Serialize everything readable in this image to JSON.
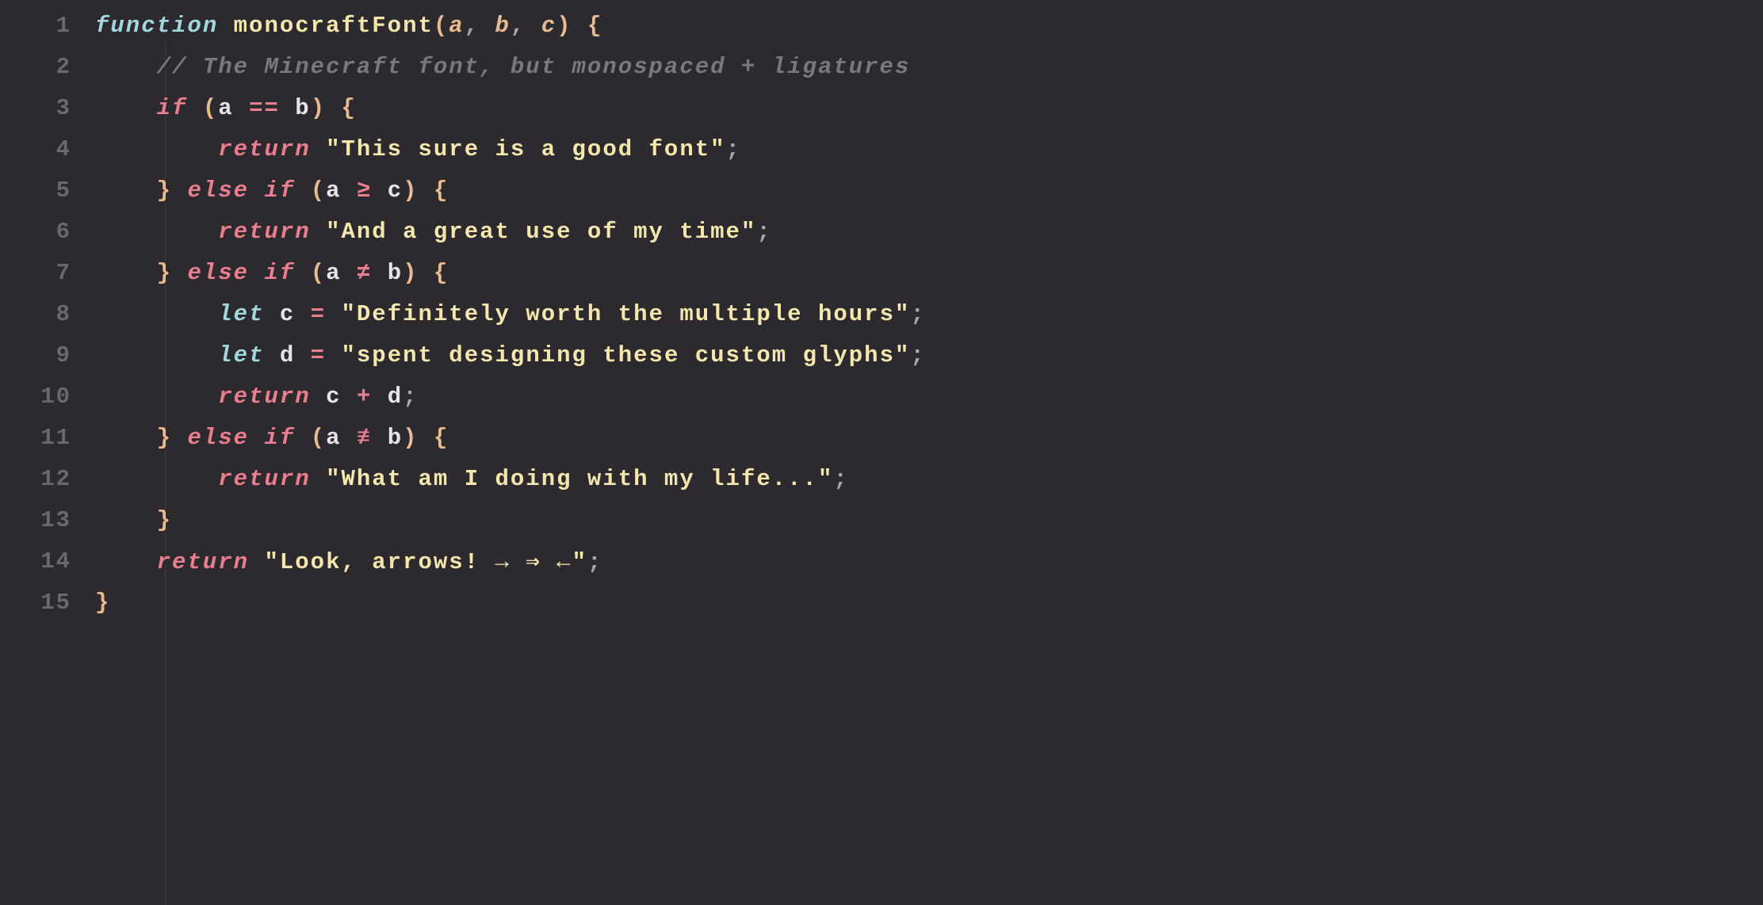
{
  "editor": {
    "line_count": 15,
    "lines": {
      "1": {
        "n": "1",
        "kw_function": "function",
        "fn_name": "monocraftFont",
        "lp": "(",
        "p1": "a",
        "c1": ",",
        "p2": "b",
        "c2": ",",
        "p3": "c",
        "rp": ")",
        "ob": "{"
      },
      "2": {
        "n": "2",
        "comment": "// The Minecraft font, but monospaced + ligatures"
      },
      "3": {
        "n": "3",
        "kw_if": "if",
        "lp": "(",
        "va": "a",
        "op": "==",
        "vb": "b",
        "rp": ")",
        "ob": "{"
      },
      "4": {
        "n": "4",
        "kw_return": "return",
        "q1": "\"",
        "str": "This sure is a good font",
        "q2": "\"",
        "semi": ";"
      },
      "5": {
        "n": "5",
        "cb": "}",
        "kw_else": "else",
        "kw_if": "if",
        "lp": "(",
        "va": "a",
        "op": "≥",
        "vc": "c",
        "rp": ")",
        "ob": "{"
      },
      "6": {
        "n": "6",
        "kw_return": "return",
        "q1": "\"",
        "str": "And a great use of my time",
        "q2": "\"",
        "semi": ";"
      },
      "7": {
        "n": "7",
        "cb": "}",
        "kw_else": "else",
        "kw_if": "if",
        "lp": "(",
        "va": "a",
        "op": "≠",
        "vb": "b",
        "rp": ")",
        "ob": "{"
      },
      "8": {
        "n": "8",
        "kw_let": "let",
        "vc": "c",
        "eq": "=",
        "q1": "\"",
        "str": "Definitely worth the multiple hours",
        "q2": "\"",
        "semi": ";"
      },
      "9": {
        "n": "9",
        "kw_let": "let",
        "vd": "d",
        "eq": "=",
        "q1": "\"",
        "str": "spent designing these custom glyphs",
        "q2": "\"",
        "semi": ";"
      },
      "10": {
        "n": "10",
        "kw_return": "return",
        "vc": "c",
        "plus": "+",
        "vd": "d",
        "semi": ";"
      },
      "11": {
        "n": "11",
        "cb": "}",
        "kw_else": "else",
        "kw_if": "if",
        "lp": "(",
        "va": "a",
        "op": "≢",
        "vb": "b",
        "rp": ")",
        "ob": "{"
      },
      "12": {
        "n": "12",
        "kw_return": "return",
        "q1": "\"",
        "str": "What am I doing with my life...",
        "q2": "\"",
        "semi": ";"
      },
      "13": {
        "n": "13",
        "cb": "}"
      },
      "14": {
        "n": "14",
        "kw_return": "return",
        "q1": "\"",
        "str": "Look, arrows! → ⇒ ←",
        "q2": "\"",
        "semi": ";"
      },
      "15": {
        "n": "15",
        "cb": "}"
      }
    }
  },
  "colors": {
    "background": "#2c2a2e",
    "lineno": "#6a686c",
    "keyword_def": "#a1d8de",
    "keyword": "#e97f8e",
    "function": "#f3e7ae",
    "paren": "#e9ba8f",
    "param": "#e9ba8f",
    "punct": "#a9a7ab",
    "brace": "#e9ba8f",
    "comment": "#7a787d",
    "variable": "#e6e4e8",
    "operator": "#e97f8e",
    "string": "#f3e7ae"
  }
}
